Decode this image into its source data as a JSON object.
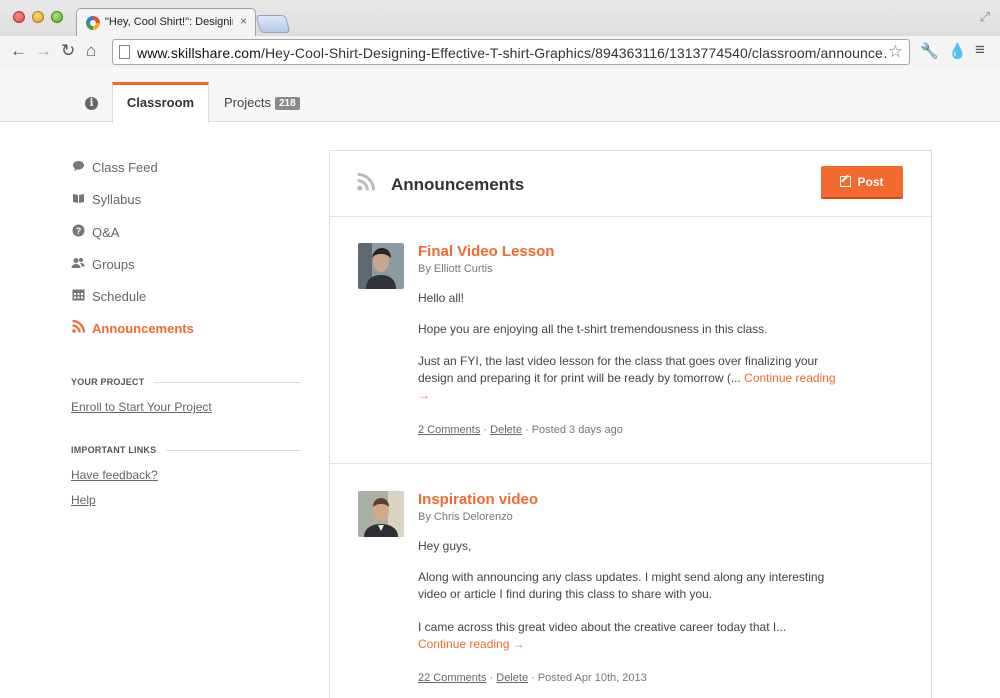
{
  "browser": {
    "tab_title": "\"Hey, Cool Shirt!\": Designin",
    "tab_close": "×",
    "url_host": "www.skillshare.com",
    "url_path": "/Hey-Cool-Shirt-Designing-Effective-T-shirt-Graphics/894363116/1313774540/classroom/announce…"
  },
  "site_nav": {
    "classroom_label": "Classroom",
    "projects_label": "Projects",
    "projects_count": "218"
  },
  "sidebar": {
    "items": [
      {
        "label": "Class Feed",
        "icon": "comment-icon"
      },
      {
        "label": "Syllabus",
        "icon": "book-icon"
      },
      {
        "label": "Q&A",
        "icon": "question-icon"
      },
      {
        "label": "Groups",
        "icon": "users-icon"
      },
      {
        "label": "Schedule",
        "icon": "calendar-icon"
      },
      {
        "label": "Announcements",
        "icon": "rss-icon",
        "active": true
      }
    ],
    "your_project_heading": "YOUR PROJECT",
    "enroll_link": "Enroll to Start Your Project",
    "important_links_heading": "IMPORTANT LINKS",
    "feedback_link": "Have feedback?",
    "help_link": "Help"
  },
  "main": {
    "title": "Announcements",
    "post_label": "Post",
    "announcements": [
      {
        "title": "Final Video Lesson",
        "author": "By Elliott Curtis",
        "p1": "Hello all!",
        "p2": "Hope you are enjoying all the t-shirt tremendousness in this class.",
        "p3": "Just an FYI, the last video lesson for the class that goes over finalizing your design and preparing it for print will be ready by tomorrow (... ",
        "continue": "Continue reading →",
        "comments": "2 Comments",
        "delete": "Delete",
        "posted": "Posted 3 days ago"
      },
      {
        "title": "Inspiration video",
        "author": "By Chris Delorenzo",
        "p1": "Hey guys,",
        "p2": "Along with announcing any class updates. I might send along any interesting video or article I find during this class to share with you.",
        "p3": "I came across this great video about the creative career today that I... ",
        "continue": "Continue reading →",
        "comments": "22 Comments",
        "delete": "Delete",
        "posted": "Posted Apr 10th, 2013"
      }
    ]
  },
  "colors": {
    "accent": "#f26a2f"
  }
}
